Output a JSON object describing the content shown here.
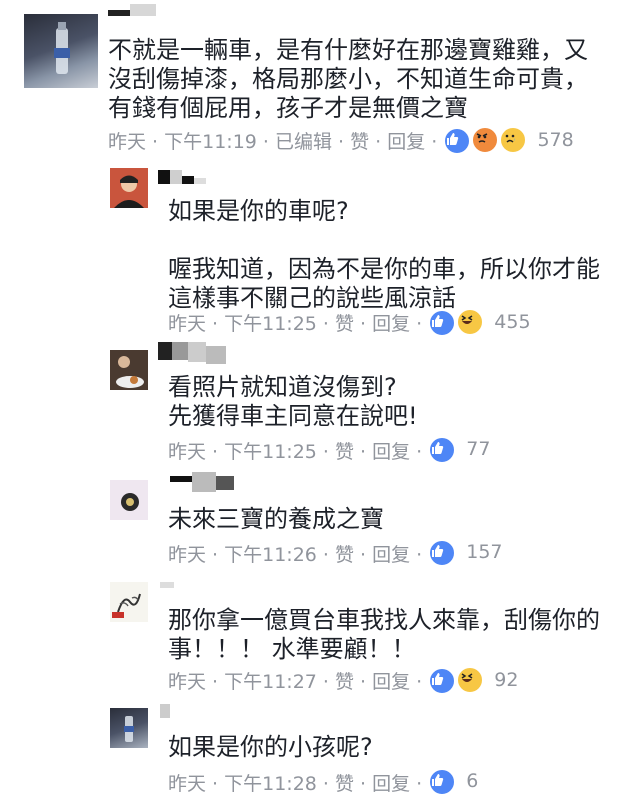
{
  "comments": [
    {
      "text": "不就是一輛車，是有什麼好在那邊寶雞雞，又\n沒刮傷掉漆，格局那麼小，不知道生命可貴，\n有錢有個屁用，孩子才是無價之寶",
      "time": "昨天 · 下午11:19 · 已编辑 · 赞 · 回复 ·",
      "reactions": [
        "like",
        "angry",
        "sad"
      ],
      "count": "578"
    },
    {
      "text": "如果是你的車呢?\n\n喔我知道，因為不是你的車，所以你才能\n這樣事不關己的說些風涼話",
      "time": "昨天 · 下午11:25 · 赞 · 回复 ·",
      "reactions": [
        "like",
        "haha"
      ],
      "count": "455"
    },
    {
      "text": "看照片就知道沒傷到?\n先獲得車主同意在說吧!",
      "time": "昨天 · 下午11:25 · 赞 · 回复 ·",
      "reactions": [
        "like"
      ],
      "count": "77"
    },
    {
      "text": "未來三寶的養成之寶",
      "time": "昨天 · 下午11:26 · 赞 · 回复 ·",
      "reactions": [
        "like"
      ],
      "count": "157"
    },
    {
      "text": "那你拿一億買台車我找人來靠，刮傷你的\n事！！！ 水準要顧！！",
      "time": "昨天 · 下午11:27 · 赞 · 回复 ·",
      "reactions": [
        "like",
        "haha"
      ],
      "count": "92"
    },
    {
      "text": "如果是你的小孩呢?",
      "time": "昨天 · 下午11:28 · 赞 · 回复 ·",
      "reactions": [
        "like"
      ],
      "count": "6"
    }
  ],
  "icons": {
    "like": "thumbs-up-icon",
    "angry": "angry-face-icon",
    "sad": "sad-face-icon",
    "haha": "laughing-face-icon"
  },
  "colors": {
    "meta_gray": "#90949c",
    "like_blue": "#4e86f6"
  }
}
